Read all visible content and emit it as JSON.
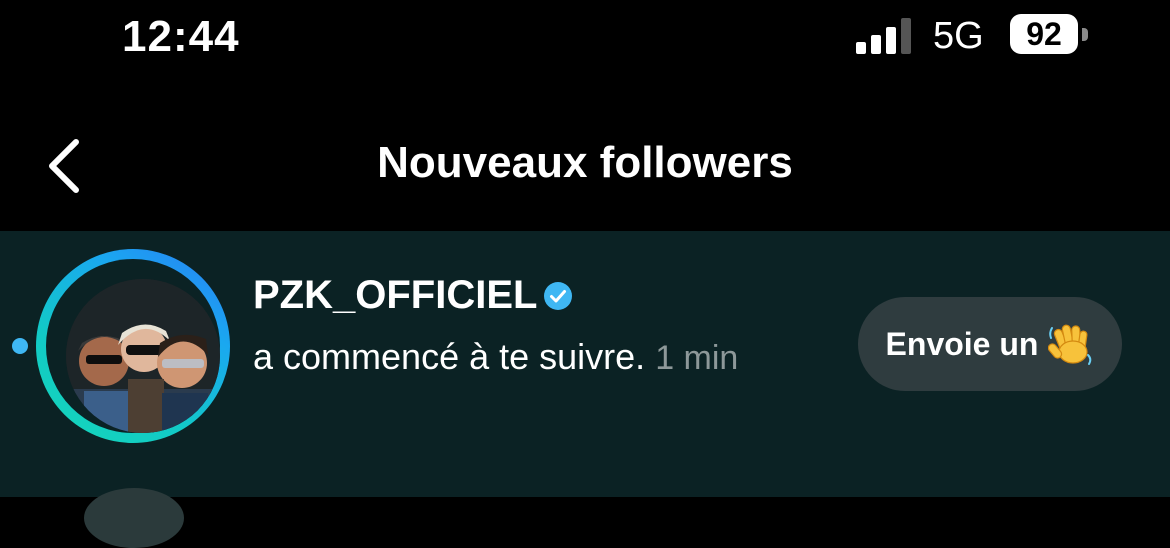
{
  "status_bar": {
    "time": "12:44",
    "network": "5G",
    "battery": "92",
    "icons": [
      "signal-icon",
      "battery-icon"
    ]
  },
  "nav": {
    "title": "Nouveaux followers",
    "back_icon": "chevron-left-icon"
  },
  "notification": {
    "username": "PZK_OFFICIEL",
    "verified": true,
    "activity": "a commencé à te suivre.",
    "timestamp": "1 min",
    "unread": true,
    "button_label": "Envoie un",
    "button_emoji": "waving-hand-icon"
  },
  "colors": {
    "row_background": "#0b2224",
    "accent_blue": "#3fb7f3",
    "button_background": "#2f3c3f",
    "timestamp_gray": "#8d9899"
  }
}
